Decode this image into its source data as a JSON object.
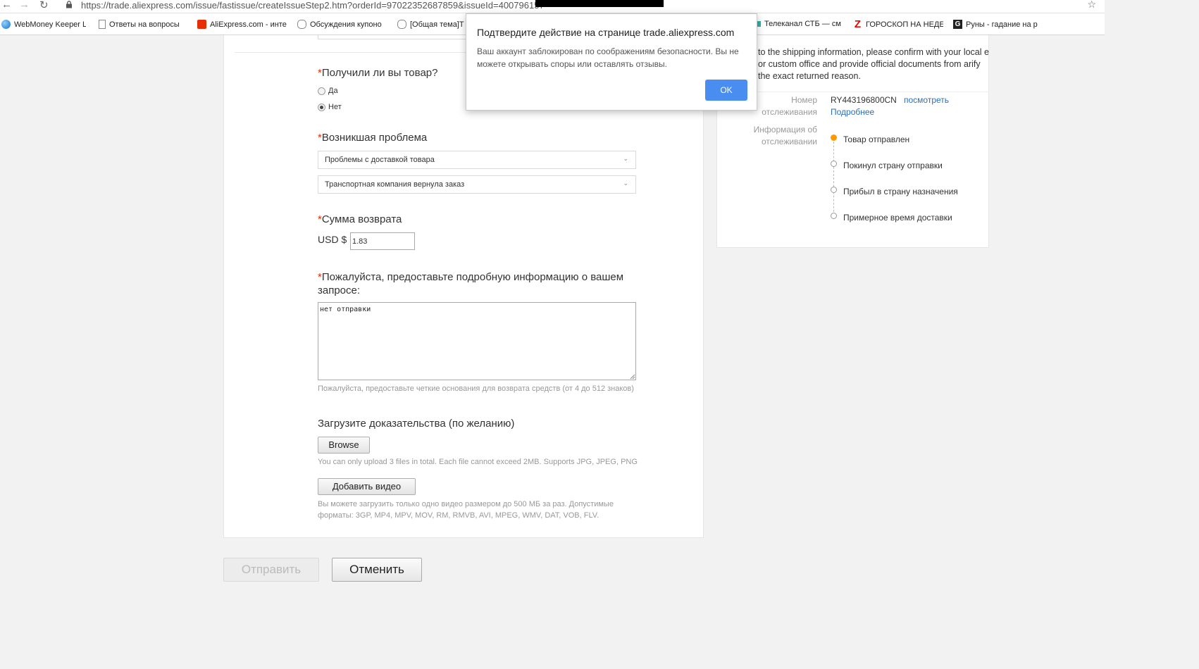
{
  "browser": {
    "url": "https://trade.aliexpress.com/issue/fastissue/createIssueStep2.htm?orderId=97022352687859&issueId=400796157"
  },
  "bookmarks": [
    {
      "label": "WebMoney Keeper L",
      "icon": "globe-icon"
    },
    {
      "label": "Ответы на вопросы",
      "icon": "page-icon"
    },
    {
      "label": "AliExpress.com - инте",
      "icon": "aliexpress-icon"
    },
    {
      "label": "Обсуждения купоно",
      "icon": "chat-icon"
    },
    {
      "label": "[Общая тема]Т",
      "icon": "chat-icon"
    },
    {
      "label": "Телеканал СТБ — см",
      "icon": "stb-icon"
    },
    {
      "label": "ГОРОСКОП НА НЕДЕ",
      "icon": "z-icon",
      "icon_text": "Z"
    },
    {
      "label": "Руны - гадание на р",
      "icon": "g-icon",
      "icon_text": "G"
    }
  ],
  "form": {
    "received": {
      "label": "Получили ли вы товар?",
      "options": [
        {
          "label": "Да",
          "checked": false
        },
        {
          "label": "Нет",
          "checked": true
        }
      ]
    },
    "problem": {
      "label": "Возникшая проблема",
      "select1": "Проблемы с доставкой товара",
      "select2": "Транспортная компания вернула заказ"
    },
    "refund": {
      "label": "Сумма возврата",
      "currency": "USD $",
      "amount": "1.83"
    },
    "details": {
      "label": "Пожалуйста, предоставьте подробную информацию о вашем запросе:",
      "value": "нет отправки",
      "hint": "Пожалуйста, предоставьте четкие основания для возврата средств (от 4 до 512 знаков)"
    },
    "evidence": {
      "label": "Загрузите доказательства (по желанию)",
      "browse": "Browse",
      "browse_hint": "You can only upload 3 files in total. Each file cannot exceed 2MB. Supports JPG, JPEG, PNG",
      "video": "Добавить видео",
      "video_hint": "Вы можете загрузить только одно видео размером до 500 МБ за раз. Допустимые форматы: 3GP, MP4, MPV, MOV, RM, RMVB, AVI, MPEG, WMV, DAT, VOB, FLV."
    },
    "required_mark": "*"
  },
  "actions": {
    "submit": "Отправить",
    "cancel": "Отменить"
  },
  "side": {
    "note": "to the shipping information, please confirm with your local e or custom office and provide official documents from arify the exact returned reason.",
    "tracking_label": "Номер отслеживания",
    "tracking_number": "RY443196800CN",
    "view_link": "посмотреть",
    "more_link": "Подробнее",
    "info_label": "Информация об отслеживании",
    "steps": [
      "Товар отправлен",
      "Покинул страну отправки",
      "Прибыл в страну назначения",
      "Примерное время доставки"
    ]
  },
  "dialog": {
    "title": "Подтвердите действие на странице trade.aliexpress.com",
    "message": "Ваш аккаунт заблокирован по соображениям безопасности. Вы не можете открывать споры или оставлять отзывы.",
    "ok": "OK"
  },
  "colors": {
    "required": "#e62e04",
    "link": "#2a6ebb",
    "ok_button": "#4a8df0",
    "timeline_active": "#ff9900"
  }
}
